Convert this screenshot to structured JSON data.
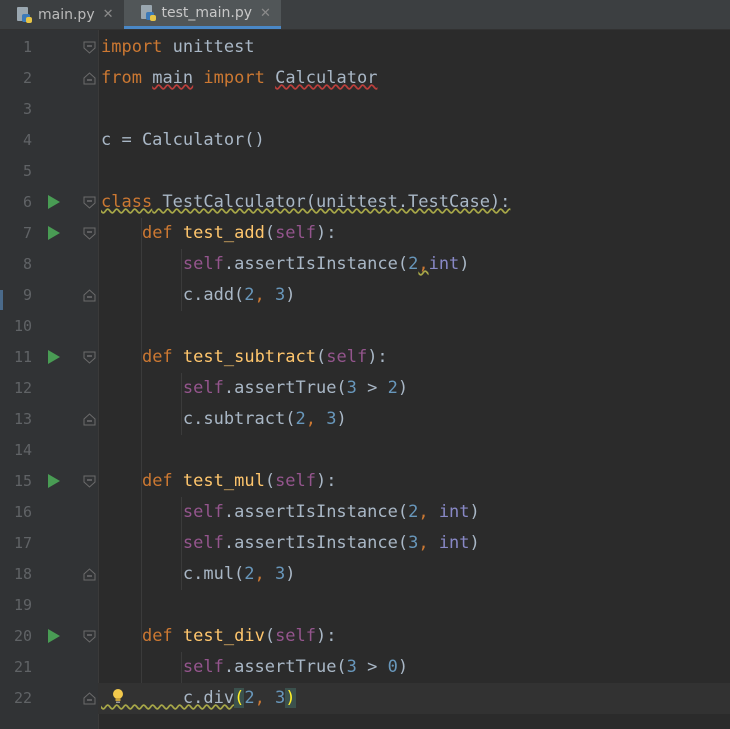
{
  "tabs": [
    {
      "label": "main.py",
      "icon": "python-file-icon",
      "active": false
    },
    {
      "label": "test_main.py",
      "icon": "python-file-icon",
      "active": true
    }
  ],
  "close_glyph": "✕",
  "colors": {
    "keyword": "#cc7832",
    "function": "#ffc66d",
    "self": "#94558d",
    "number": "#6897bb",
    "builtin": "#8888c6",
    "text": "#a9b7c6",
    "run_icon": "#499c54",
    "background": "#2b2b2b"
  },
  "lines": [
    {
      "n": "1",
      "tokens": [
        [
          "kw",
          "import"
        ],
        [
          "pl",
          " unittest"
        ]
      ]
    },
    {
      "n": "2",
      "tokens": [
        [
          "kw",
          "from"
        ],
        [
          "pl",
          " "
        ],
        [
          "pl-sq",
          "main"
        ],
        [
          "pl",
          " "
        ],
        [
          "kw",
          "import"
        ],
        [
          "pl",
          " "
        ],
        [
          "pl-sq",
          "Calculator"
        ]
      ]
    },
    {
      "n": "3",
      "tokens": []
    },
    {
      "n": "4",
      "tokens": [
        [
          "pl",
          "c = Calculator()"
        ]
      ]
    },
    {
      "n": "5",
      "tokens": []
    },
    {
      "n": "6",
      "tokens": [
        [
          "kw-sqy",
          "class"
        ],
        [
          "pl-sqy",
          " TestCalculator(unittest.TestCase):"
        ]
      ]
    },
    {
      "n": "7",
      "tokens": [
        [
          "pl",
          "    "
        ],
        [
          "kw",
          "def"
        ],
        [
          "pl",
          " "
        ],
        [
          "fn",
          "test_add"
        ],
        [
          "pl",
          "("
        ],
        [
          "self",
          "self"
        ],
        [
          "pl",
          "):"
        ]
      ]
    },
    {
      "n": "8",
      "tokens": [
        [
          "pl",
          "        "
        ],
        [
          "self",
          "self"
        ],
        [
          "pl",
          ".assertIsInstance("
        ],
        [
          "num",
          "2"
        ],
        [
          "kw-sqy",
          ","
        ],
        [
          "bi",
          "int"
        ],
        [
          "pl",
          ")"
        ]
      ]
    },
    {
      "n": "9",
      "tokens": [
        [
          "pl",
          "        c.add("
        ],
        [
          "num",
          "2"
        ],
        [
          "kw",
          ", "
        ],
        [
          "num",
          "3"
        ],
        [
          "pl",
          ")"
        ]
      ]
    },
    {
      "n": "10",
      "tokens": []
    },
    {
      "n": "11",
      "tokens": [
        [
          "pl",
          "    "
        ],
        [
          "kw",
          "def"
        ],
        [
          "pl",
          " "
        ],
        [
          "fn",
          "test_subtract"
        ],
        [
          "pl",
          "("
        ],
        [
          "self",
          "self"
        ],
        [
          "pl",
          "):"
        ]
      ]
    },
    {
      "n": "12",
      "tokens": [
        [
          "pl",
          "        "
        ],
        [
          "self",
          "self"
        ],
        [
          "pl",
          ".assertTrue("
        ],
        [
          "num",
          "3"
        ],
        [
          "pl",
          " > "
        ],
        [
          "num",
          "2"
        ],
        [
          "pl",
          ")"
        ]
      ]
    },
    {
      "n": "13",
      "tokens": [
        [
          "pl",
          "        c.subtract("
        ],
        [
          "num",
          "2"
        ],
        [
          "kw",
          ", "
        ],
        [
          "num",
          "3"
        ],
        [
          "pl",
          ")"
        ]
      ]
    },
    {
      "n": "14",
      "tokens": []
    },
    {
      "n": "15",
      "tokens": [
        [
          "pl",
          "    "
        ],
        [
          "kw",
          "def"
        ],
        [
          "pl",
          " "
        ],
        [
          "fn",
          "test_mul"
        ],
        [
          "pl",
          "("
        ],
        [
          "self",
          "self"
        ],
        [
          "pl",
          "):"
        ]
      ]
    },
    {
      "n": "16",
      "tokens": [
        [
          "pl",
          "        "
        ],
        [
          "self",
          "self"
        ],
        [
          "pl",
          ".assertIsInstance("
        ],
        [
          "num",
          "2"
        ],
        [
          "kw",
          ", "
        ],
        [
          "bi",
          "int"
        ],
        [
          "pl",
          ")"
        ]
      ]
    },
    {
      "n": "17",
      "tokens": [
        [
          "pl",
          "        "
        ],
        [
          "self",
          "self"
        ],
        [
          "pl",
          ".assertIsInstance("
        ],
        [
          "num",
          "3"
        ],
        [
          "kw",
          ", "
        ],
        [
          "bi",
          "int"
        ],
        [
          "pl",
          ")"
        ]
      ]
    },
    {
      "n": "18",
      "tokens": [
        [
          "pl",
          "        c.mul("
        ],
        [
          "num",
          "2"
        ],
        [
          "kw",
          ", "
        ],
        [
          "num",
          "3"
        ],
        [
          "pl",
          ")"
        ]
      ]
    },
    {
      "n": "19",
      "tokens": []
    },
    {
      "n": "20",
      "tokens": [
        [
          "pl",
          "    "
        ],
        [
          "kw",
          "def"
        ],
        [
          "pl",
          " "
        ],
        [
          "fn",
          "test_div"
        ],
        [
          "pl",
          "("
        ],
        [
          "self",
          "self"
        ],
        [
          "pl",
          "):"
        ]
      ]
    },
    {
      "n": "21",
      "tokens": [
        [
          "pl",
          "        "
        ],
        [
          "self",
          "self"
        ],
        [
          "pl",
          ".assertTrue("
        ],
        [
          "num",
          "3"
        ],
        [
          "pl",
          " > "
        ],
        [
          "num",
          "0"
        ],
        [
          "pl",
          ")"
        ]
      ]
    },
    {
      "n": "22",
      "tokens": [
        [
          "pl-sqy",
          "        c.div"
        ],
        [
          "brace",
          "("
        ],
        [
          "num",
          "2"
        ],
        [
          "kw",
          ", "
        ],
        [
          "num",
          "3"
        ],
        [
          "brace",
          ")"
        ]
      ]
    }
  ],
  "run_lines": [
    "6",
    "7",
    "11",
    "15",
    "20"
  ],
  "fold_open_lines": [
    "1",
    "6",
    "7",
    "11",
    "15",
    "20"
  ],
  "fold_close_lines": [
    "2",
    "9",
    "13",
    "18",
    "22"
  ],
  "current_line": "22"
}
